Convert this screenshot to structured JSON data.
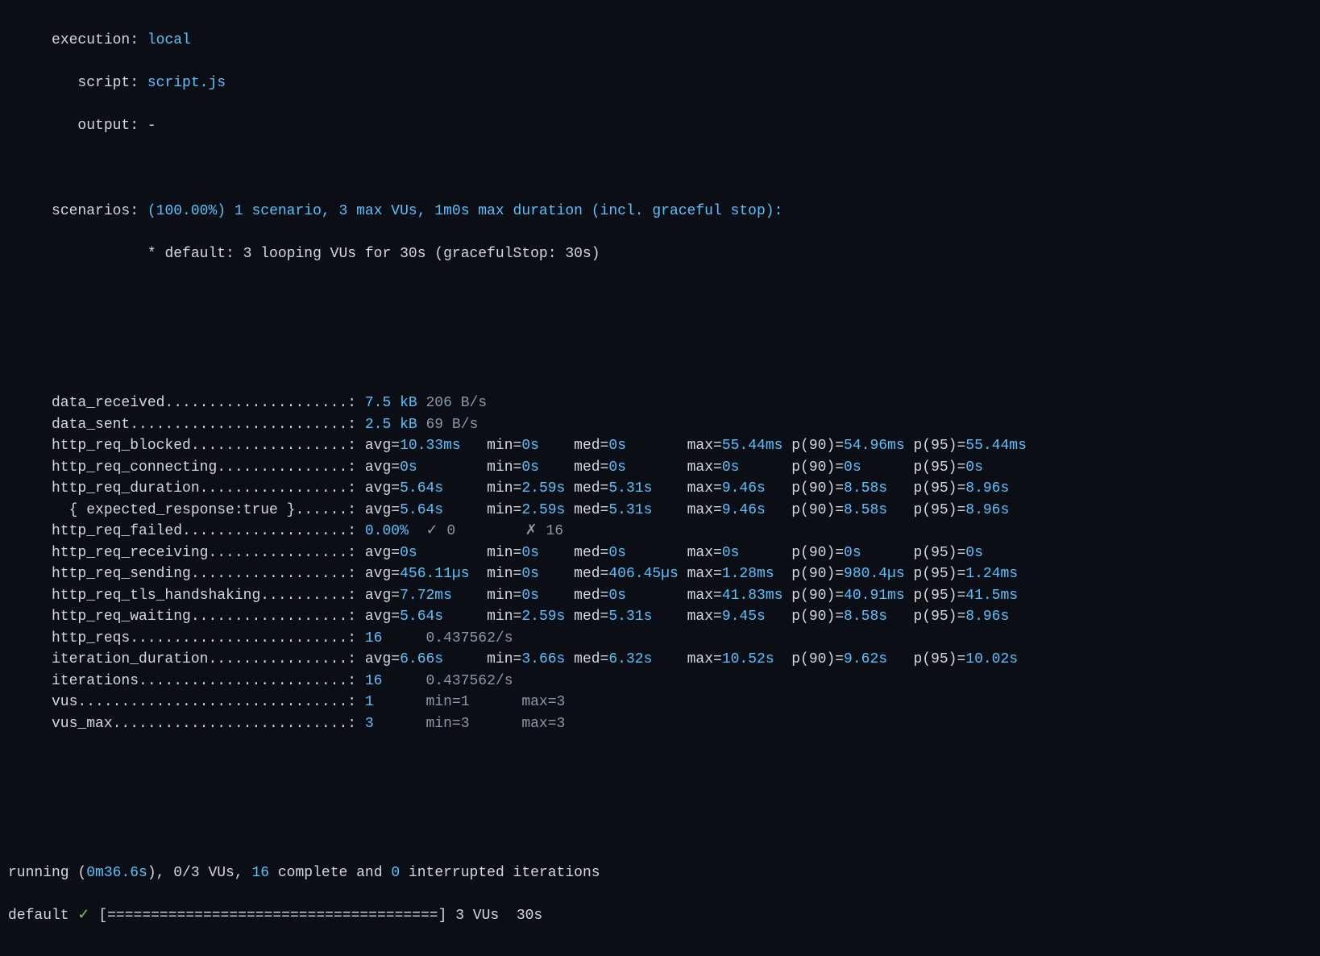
{
  "header": {
    "execution_label": "execution: ",
    "execution_value": "local",
    "script_label": "script: ",
    "script_value": "script.js",
    "output_label": "output: ",
    "output_value": "-",
    "scenarios_label": "scenarios: ",
    "scenarios_value": "(100.00%) 1 scenario, 3 max VUs, 1m0s max duration (incl. graceful stop):",
    "scenarios_detail_prefix": "           * default: ",
    "scenarios_detail_rest": "3 looping VUs for 30s (gracefulStop: 30s)"
  },
  "metrics": {
    "label_width": 34,
    "data_received_name": "data_received",
    "data_received_v1": "7.5 kB",
    "data_received_v2": "206 B/s",
    "data_sent_name": "data_sent",
    "data_sent_v1": "2.5 kB",
    "data_sent_v2": "69 B/s",
    "http_req_blocked_name": "http_req_blocked",
    "http_req_blocked": {
      "avg": "10.33ms",
      "min": "0s",
      "med": "0s",
      "max": "55.44ms",
      "p90": "54.96ms",
      "p95": "55.44ms"
    },
    "http_req_connecting_name": "http_req_connecting",
    "http_req_connecting": {
      "avg": "0s",
      "min": "0s",
      "med": "0s",
      "max": "0s",
      "p90": "0s",
      "p95": "0s"
    },
    "http_req_duration_name": "http_req_duration",
    "http_req_duration": {
      "avg": "5.64s",
      "min": "2.59s",
      "med": "5.31s",
      "max": "9.46s",
      "p90": "8.58s",
      "p95": "8.96s"
    },
    "http_req_duration_sub_name": "  { expected_response:true }",
    "http_req_duration_sub": {
      "avg": "5.64s",
      "min": "2.59s",
      "med": "5.31s",
      "max": "9.46s",
      "p90": "8.58s",
      "p95": "8.96s"
    },
    "http_req_failed_name": "http_req_failed",
    "http_req_failed_pct": "0.00%",
    "http_req_failed_pass_sym": "✓",
    "http_req_failed_pass": "0",
    "http_req_failed_fail_sym": "✗",
    "http_req_failed_fail": "16",
    "http_req_receiving_name": "http_req_receiving",
    "http_req_receiving": {
      "avg": "0s",
      "min": "0s",
      "med": "0s",
      "max": "0s",
      "p90": "0s",
      "p95": "0s"
    },
    "http_req_sending_name": "http_req_sending",
    "http_req_sending": {
      "avg": "456.11µs",
      "min": "0s",
      "med": "406.45µs",
      "max": "1.28ms",
      "p90": "980.4µs",
      "p95": "1.24ms"
    },
    "http_req_tls_handshaking_name": "http_req_tls_handshaking",
    "http_req_tls_handshaking": {
      "avg": "7.72ms",
      "min": "0s",
      "med": "0s",
      "max": "41.83ms",
      "p90": "40.91ms",
      "p95": "41.5ms"
    },
    "http_req_waiting_name": "http_req_waiting",
    "http_req_waiting": {
      "avg": "5.64s",
      "min": "2.59s",
      "med": "5.31s",
      "max": "9.45s",
      "p90": "8.58s",
      "p95": "8.96s"
    },
    "http_reqs_name": "http_reqs",
    "http_reqs_v1": "16",
    "http_reqs_v2": "0.437562/s",
    "iteration_duration_name": "iteration_duration",
    "iteration_duration": {
      "avg": "6.66s",
      "min": "3.66s",
      "med": "6.32s",
      "max": "10.52s",
      "p90": "9.62s",
      "p95": "10.02s"
    },
    "iterations_name": "iterations",
    "iterations_v1": "16",
    "iterations_v2": "0.437562/s",
    "vus_name": "vus",
    "vus_v": "1",
    "vus_min": "min=1",
    "vus_max": "max=3",
    "vus_max_name": "vus_max",
    "vus_max_v": "3",
    "vus_max_min": "min=3",
    "vus_max_max": "max=3"
  },
  "footer": {
    "line1_a": "running (",
    "line1_time": "0m36.6s",
    "line1_b": "), ",
    "line1_vus": "0/3",
    "line1_c": " VUs, ",
    "line1_complete": "16",
    "line1_d": " complete and ",
    "line1_interrupted": "0",
    "line1_e": " interrupted iterations",
    "line2_scn": "default ",
    "line2_check": "✓",
    "line2_bar": " [======================================] ",
    "line2_tail": "3 VUs  30s"
  }
}
